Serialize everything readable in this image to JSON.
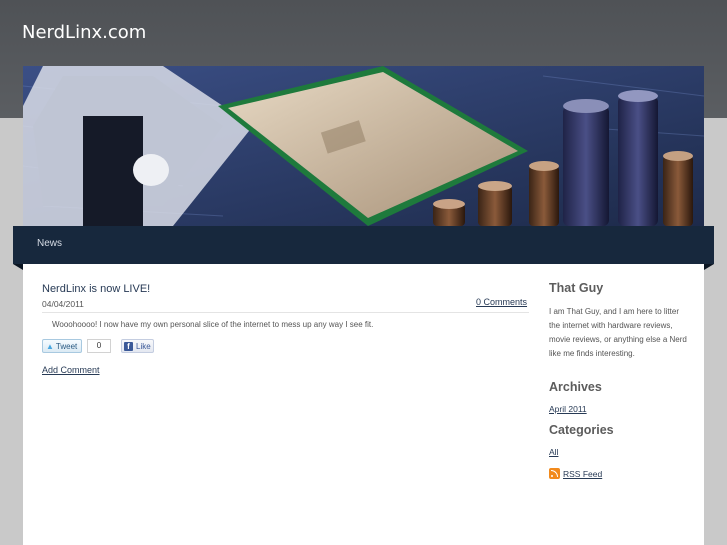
{
  "header": {
    "site_title": "NerdLinx.com"
  },
  "hero": {
    "image_icon": "motherboard-cpu-photo"
  },
  "nav": {
    "items": [
      {
        "label": "News"
      }
    ]
  },
  "post": {
    "title": "NerdLinx is now LIVE!",
    "date": "04/04/2011",
    "comments_link": "0 Comments",
    "body": "Wooohoooo! I now have my own personal slice of the internet to mess up any way I see fit.",
    "tweet_label": "Tweet",
    "tweet_count": "0",
    "like_label": "Like",
    "add_comment": "Add Comment"
  },
  "sidebar": {
    "about_heading": "That Guy",
    "about_text": "I am That Guy, and I am here to litter the internet with hardware reviews, movie reviews, or anything else a Nerd like me finds interesting.",
    "archives_heading": "Archives",
    "archives": [
      {
        "label": "April 2011"
      }
    ],
    "categories_heading": "Categories",
    "categories": [
      {
        "label": "All"
      }
    ],
    "rss_label": "RSS Feed"
  },
  "colors": {
    "header_bg": "#53575b",
    "nav_bg": "#17283d",
    "link": "#273a55",
    "page_bg": "#c9c9c9"
  }
}
